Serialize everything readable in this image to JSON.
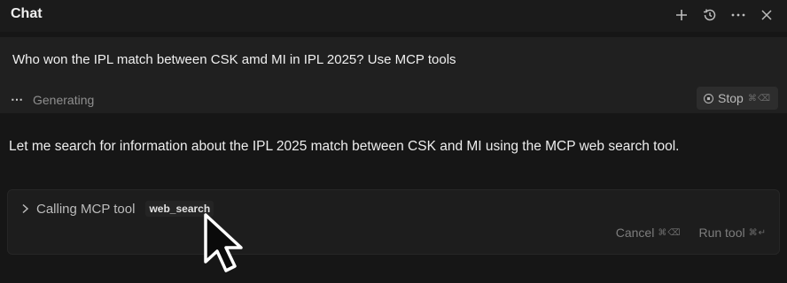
{
  "header": {
    "title": "Chat",
    "icons": [
      "plus-icon",
      "history-icon",
      "more-icon",
      "close-icon"
    ]
  },
  "prompt": {
    "text": "Who won the IPL match between CSK amd MI in IPL 2025? Use MCP tools"
  },
  "status": {
    "dots": "⋯",
    "label": "Generating",
    "stop_label": "Stop",
    "stop_shortcut": "⌘⌫"
  },
  "assistant": {
    "message": "Let me search for information about the IPL 2025 match between CSK and MI using the MCP web search tool."
  },
  "tool_call": {
    "label": "Calling MCP tool",
    "tool_name": "web_search",
    "cancel_label": "Cancel",
    "cancel_shortcut": "⌘⌫",
    "run_label": "Run tool",
    "run_shortcut": "⌘↵"
  },
  "colors": {
    "background": "#161616",
    "panel": "#202020",
    "text": "#e6e6e6",
    "muted": "#8f8f8f"
  }
}
